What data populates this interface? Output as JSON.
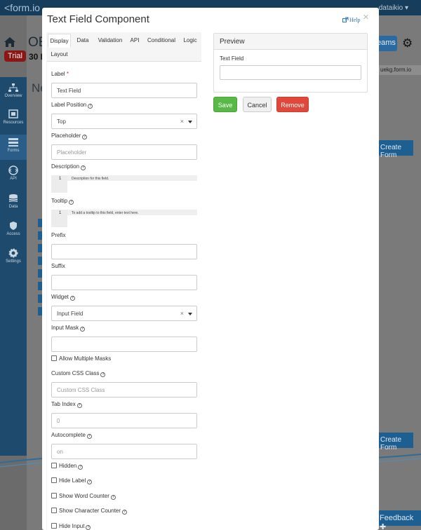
{
  "background": {
    "logo": "<form.io",
    "user": "dataikio ▾",
    "title": "OE",
    "trial_badge": "Trial",
    "days": "30 D",
    "teams_btn": "eams",
    "url_text": "uekg.form.io",
    "big_letter": "Ne",
    "create_form_1": "Create Form",
    "create_form_2": "Create Form",
    "feedback": "Feedback ✚",
    "sidebar": [
      {
        "label": "Overview",
        "icon": "overview-icon"
      },
      {
        "label": "Resources",
        "icon": "resources-icon"
      },
      {
        "label": "Forms",
        "icon": "forms-icon"
      },
      {
        "label": "API",
        "icon": "api-icon"
      },
      {
        "label": "Data",
        "icon": "data-icon"
      },
      {
        "label": "Access",
        "icon": "access-icon"
      },
      {
        "label": "Settings",
        "icon": "settings-icon"
      }
    ]
  },
  "modal": {
    "title": "Text Field Component",
    "help": "Help",
    "close": "×",
    "tabs": [
      "Display",
      "Data",
      "Validation",
      "API",
      "Conditional",
      "Logic",
      "Layout"
    ],
    "active_tab": "Display",
    "fields": {
      "label": {
        "label": "Label",
        "required_mark": "*",
        "value": "Text Field"
      },
      "label_position": {
        "label": "Label Position",
        "value": "Top"
      },
      "placeholder": {
        "label": "Placeholder",
        "placeholder": "Placeholder"
      },
      "description": {
        "label": "Description",
        "line_no": "1",
        "hint": "Description for this field."
      },
      "tooltip": {
        "label": "Tooltip",
        "line_no": "1",
        "hint": "To add a tooltip to this field, enter text here."
      },
      "prefix": {
        "label": "Prefix"
      },
      "suffix": {
        "label": "Suffix"
      },
      "widget": {
        "label": "Widget",
        "value": "Input Field"
      },
      "input_mask": {
        "label": "Input Mask"
      },
      "allow_multiple_masks": {
        "label": "Allow Multiple Masks"
      },
      "custom_css": {
        "label": "Custom CSS Class",
        "placeholder": "Custom CSS Class"
      },
      "tab_index": {
        "label": "Tab Index",
        "placeholder": "0"
      },
      "autocomplete": {
        "label": "Autocomplete",
        "placeholder": "on"
      },
      "hidden": {
        "label": "Hidden"
      },
      "hide_label": {
        "label": "Hide Label"
      },
      "show_word_counter": {
        "label": "Show Word Counter"
      },
      "show_char_counter": {
        "label": "Show Character Counter"
      },
      "hide_input": {
        "label": "Hide Input"
      }
    },
    "preview": {
      "heading": "Preview",
      "field_label": "Text Field"
    },
    "buttons": {
      "save": "Save",
      "cancel": "Cancel",
      "remove": "Remove"
    },
    "colors": {
      "save": "#58b947",
      "remove": "#e0483c",
      "link": "#3275b8"
    }
  }
}
